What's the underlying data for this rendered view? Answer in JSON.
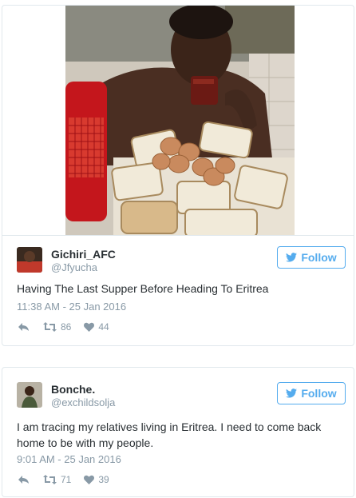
{
  "tweets": [
    {
      "display_name": "Gichiri_AFC",
      "handle": "@Jfyucha",
      "follow_label": "Follow",
      "text": "Having The Last Supper Before Heading To Eritrea",
      "timestamp": "11:38 AM - 25 Jan 2016",
      "retweets": "86",
      "likes": "44"
    },
    {
      "display_name": "Bonche.",
      "handle": "@exchildsolja",
      "follow_label": "Follow",
      "text_line1": "I am tracing my relatives living in Eritrea. I need to come back",
      "text_line2": "home to be with my people.",
      "timestamp": "9:01 AM - 25 Jan 2016",
      "retweets": "71",
      "likes": "39"
    }
  ],
  "colors": {
    "accent": "#55acee",
    "muted": "#8899a6",
    "text": "#292f33",
    "border": "#e1e8ed"
  }
}
